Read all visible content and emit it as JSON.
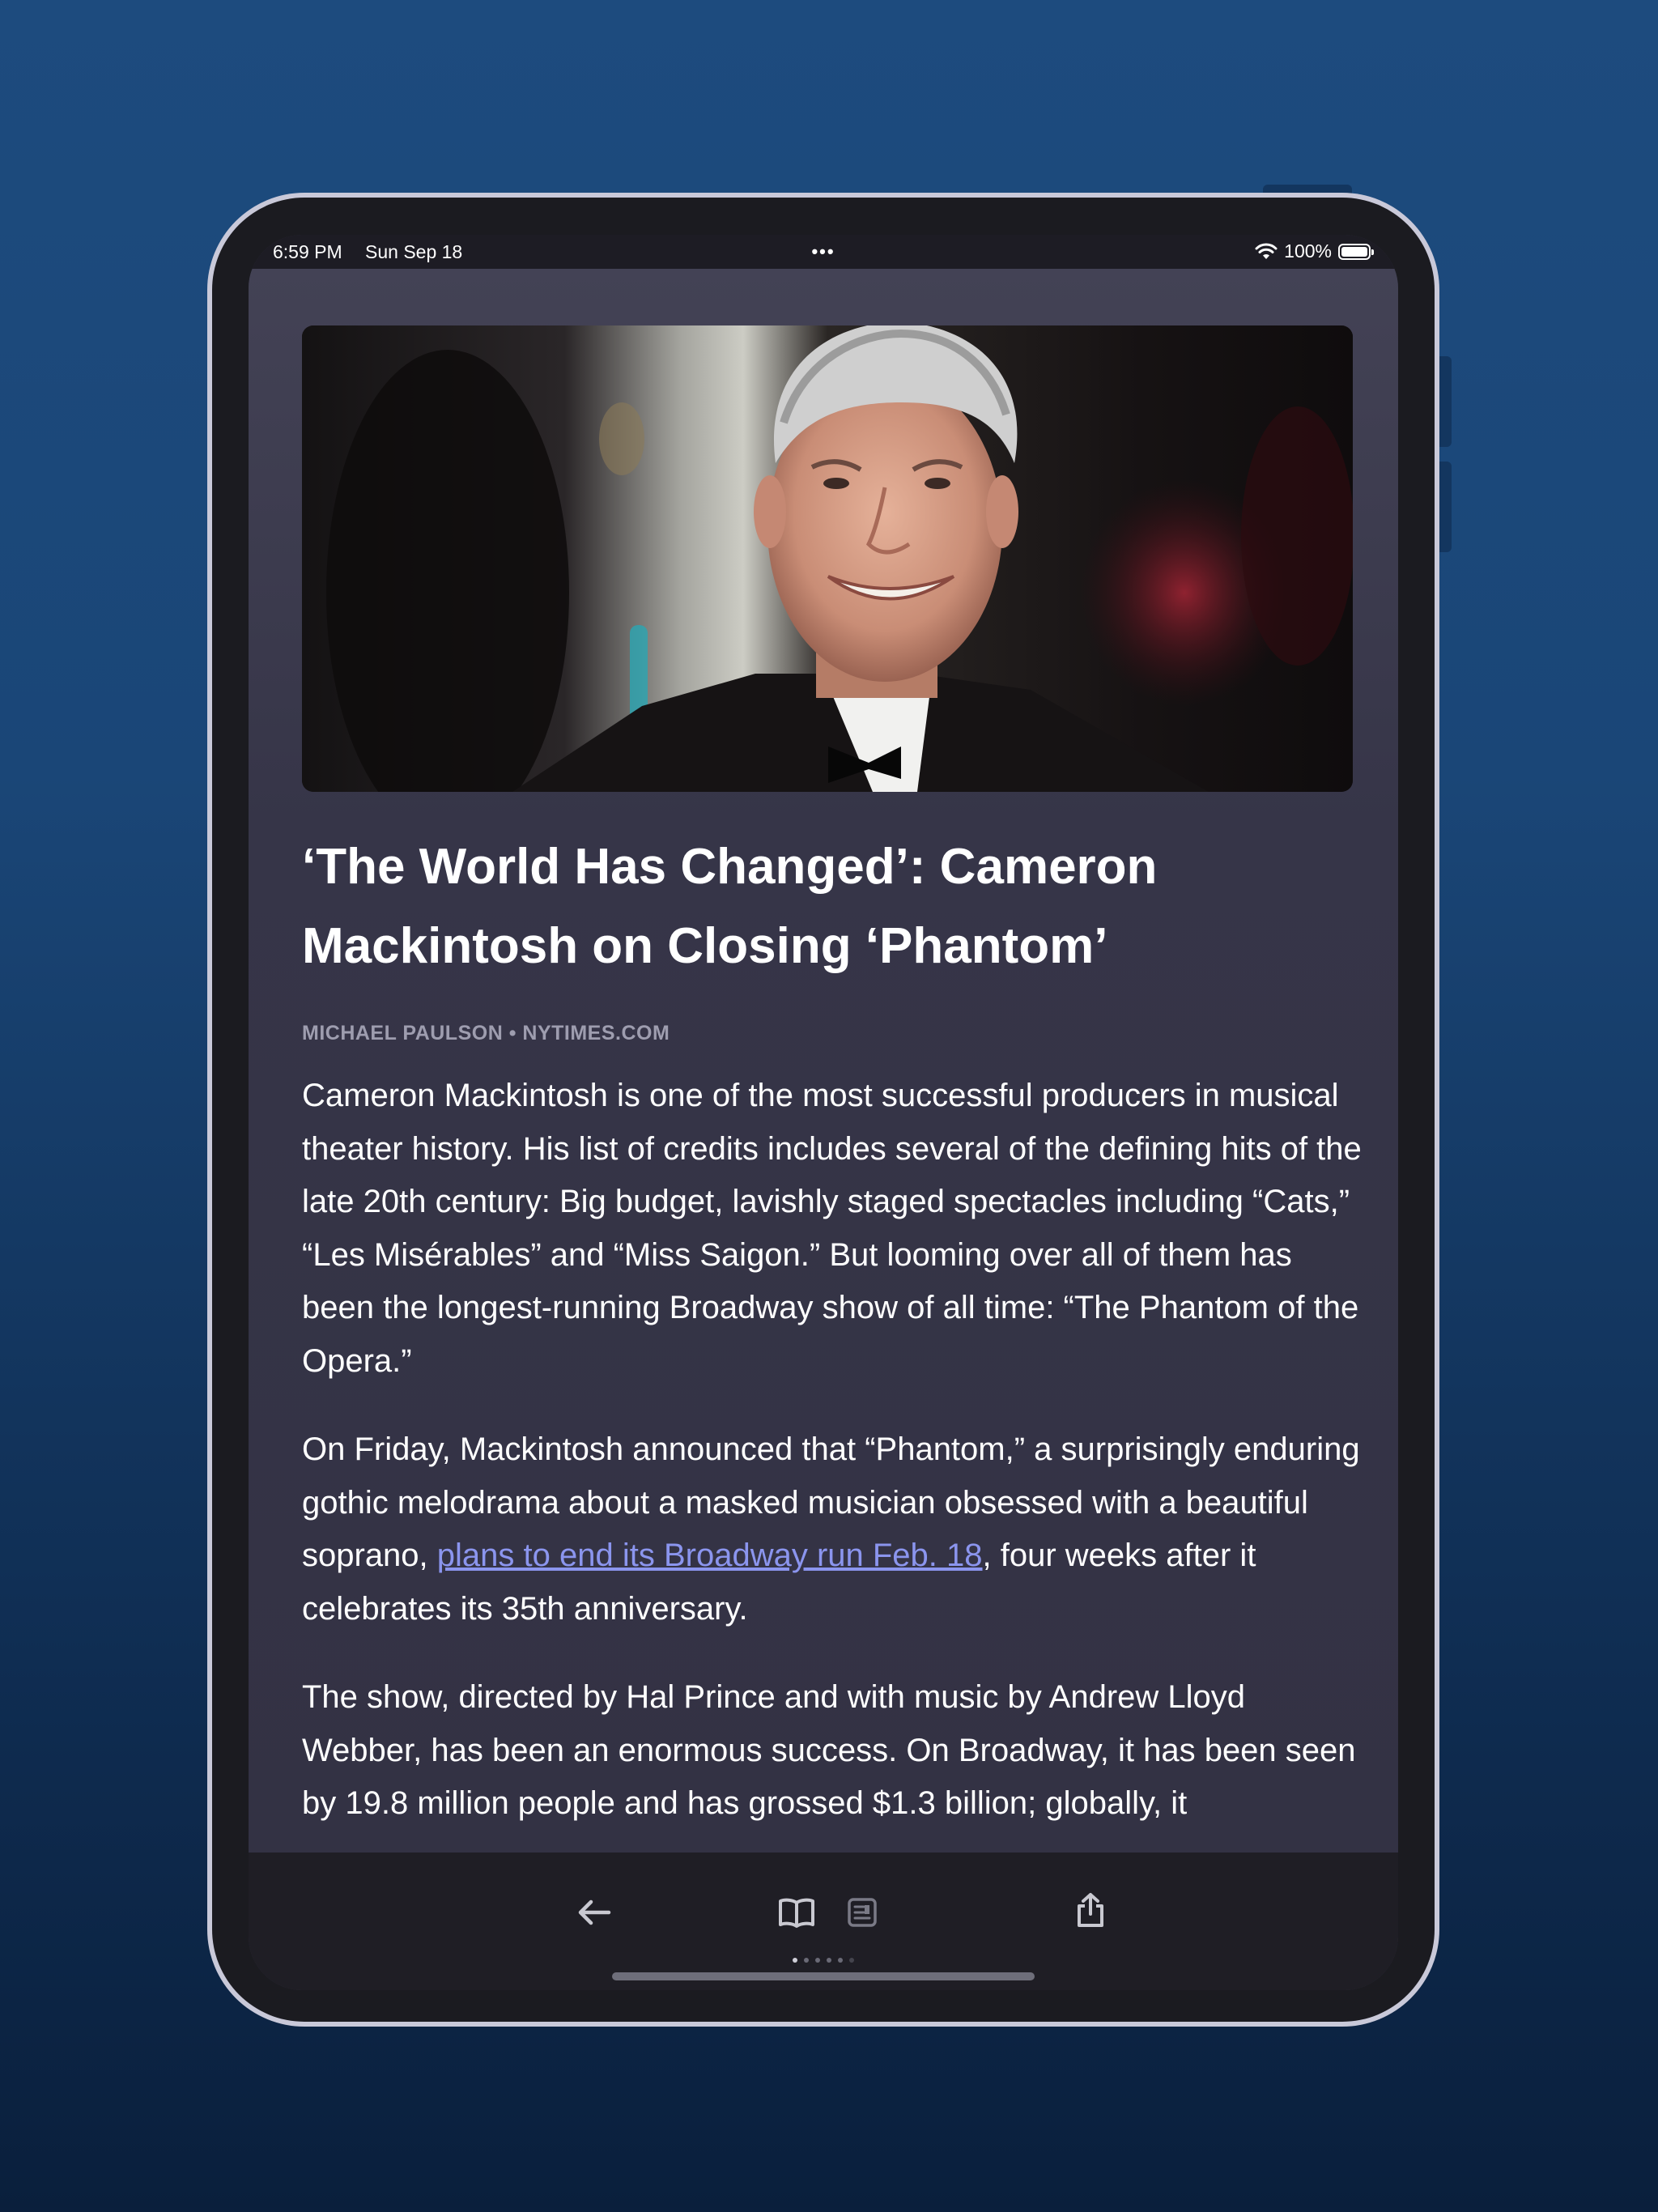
{
  "status_bar": {
    "time": "6:59 PM",
    "date": "Sun Sep 18",
    "battery_percent": "100%",
    "battery_level": 1.0
  },
  "article": {
    "headline": "‘The World Has Changed’: Cameron Mackintosh on Closing ‘Phantom’",
    "byline": "MICHAEL PAULSON • NYTIMES.COM",
    "paragraph1": "Cameron Mackintosh is one of the most successful producers in musical theater history. His list of credits includes several of the defining hits of the late 20th century: Big budget, lavishly staged spectacles including “Cats,” “Les Misérables” and “Miss Saigon.” But looming over all of them has been the longest-running Broadway show of all time: “The Phantom of the Opera.”",
    "paragraph2_before": "On Friday, Mackintosh announced that “Phantom,” a surprisingly enduring gothic melodrama about a masked musician obsessed with a beautiful soprano, ",
    "paragraph2_link": "plans to end its Broadway run Feb. 18",
    "paragraph2_after": ", four weeks after it celebrates its 35th anniversary.",
    "paragraph3": "The show, directed by Hal Prince and with music by Andrew Lloyd Webber, has been an enormous success. On Broadway, it has been seen by 19.8 million people and has grossed $1.3 billion; globally, it"
  },
  "toolbar": {
    "icons": [
      "back-arrow-icon",
      "book-icon",
      "reader-icon",
      "share-icon"
    ]
  },
  "colors": {
    "background": "#1a4677",
    "screen": "#363548",
    "link": "#8b95ee"
  }
}
